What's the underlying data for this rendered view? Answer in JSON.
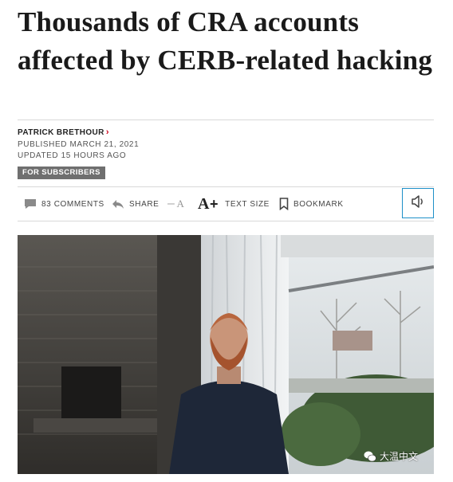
{
  "article": {
    "headline": "Thousands of CRA accounts affected by CERB-related hacking",
    "author": "PATRICK BRETHOUR",
    "author_chevron": "›",
    "published": "PUBLISHED MARCH 21, 2021",
    "updated": "UPDATED 15 HOURS AGO",
    "badge": "FOR SUBSCRIBERS"
  },
  "toolbar": {
    "comments_label": "83 COMMENTS",
    "share_label": "SHARE",
    "text_size_decrease": "A",
    "text_size_increase": "A",
    "text_size_label": "TEXT SIZE",
    "bookmark_label": "BOOKMARK"
  },
  "icons": {
    "comments": "comment-bubble-icon",
    "share": "share-arrow-icon",
    "bookmark": "bookmark-icon",
    "audio": "speaker-icon",
    "watermark": "wechat-icon"
  },
  "watermark": {
    "text": "大温中文"
  },
  "colors": {
    "author_accent": "#d0021b",
    "audio_border": "#1e90c8",
    "badge_bg": "#6f6f6f"
  }
}
